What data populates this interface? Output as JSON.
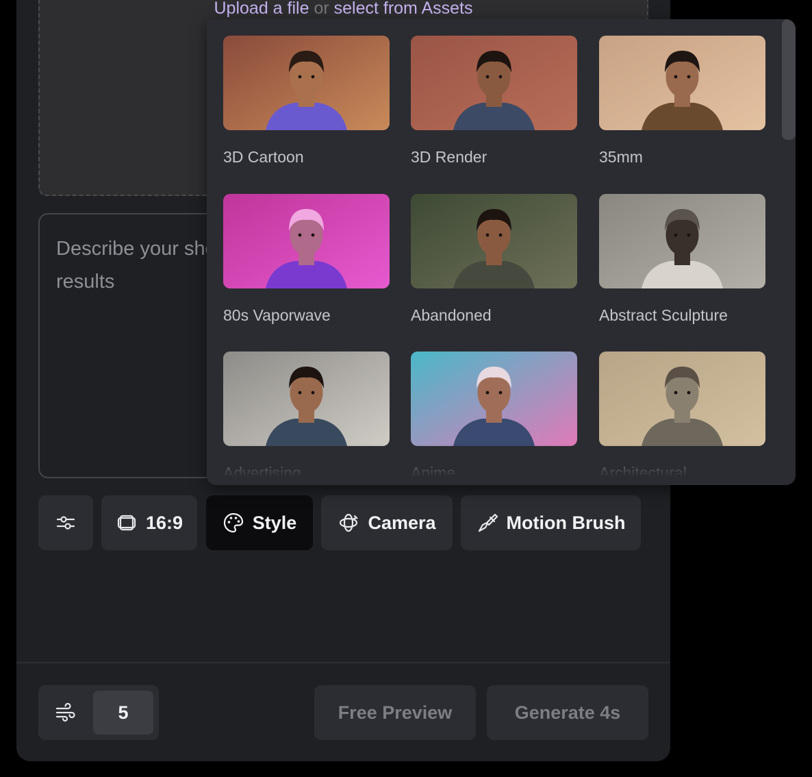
{
  "upload": {
    "prefix": "Upload a file",
    "or": "or",
    "link": "select from Assets"
  },
  "prompt": {
    "placeholder": "Describe your shot and choose from the options for specific results"
  },
  "toolbar": {
    "aspect_label": "16:9",
    "style_label": "Style",
    "camera_label": "Camera",
    "motion_brush_label": "Motion Brush"
  },
  "bottom": {
    "count_value": "5",
    "free_preview_label": "Free Preview",
    "generate_label": "Generate 4s"
  },
  "styles": [
    {
      "label": "3D Cartoon",
      "bg": "#8a4b3b",
      "bg2": "#c98a5a",
      "skin": "#a9714e",
      "hair": "#2a1b14",
      "shirt": "#6a5ad0"
    },
    {
      "label": "3D Render",
      "bg": "#9b5546",
      "bg2": "#b86e58",
      "skin": "#8a5a40",
      "hair": "#1d1410",
      "shirt": "#3d4a66"
    },
    {
      "label": "35mm",
      "bg": "#c8a284",
      "bg2": "#e3c2a2",
      "skin": "#9a6a4e",
      "hair": "#1e1612",
      "shirt": "#6a4a2e"
    },
    {
      "label": "80s Vaporwave",
      "bg": "#c0359a",
      "bg2": "#e65ad0",
      "skin": "#b06a8a",
      "hair": "#f0a8e0",
      "shirt": "#7a3ad0"
    },
    {
      "label": "Abandoned",
      "bg": "#3e4a34",
      "bg2": "#6e7058",
      "skin": "#8a5a40",
      "hair": "#1d1410",
      "shirt": "#464a3e"
    },
    {
      "label": "Abstract Sculpture",
      "bg": "#8a8780",
      "bg2": "#b3b0a8",
      "skin": "#3a302a",
      "hair": "#5a544c",
      "shirt": "#d8d4cc"
    },
    {
      "label": "Advertising",
      "bg": "#8e8c88",
      "bg2": "#cfccc6",
      "skin": "#9a6a4e",
      "hair": "#1d1410",
      "shirt": "#3a4a5e"
    },
    {
      "label": "Anime",
      "bg": "#4ab8c8",
      "bg2": "#e07ab8",
      "skin": "#a06e58",
      "hair": "#e8d8e0",
      "shirt": "#3a4a70"
    },
    {
      "label": "Architectural",
      "bg": "#b8a486",
      "bg2": "#d2c0a0",
      "skin": "#8a8070",
      "hair": "#5a5046",
      "shirt": "#6e685c"
    }
  ]
}
